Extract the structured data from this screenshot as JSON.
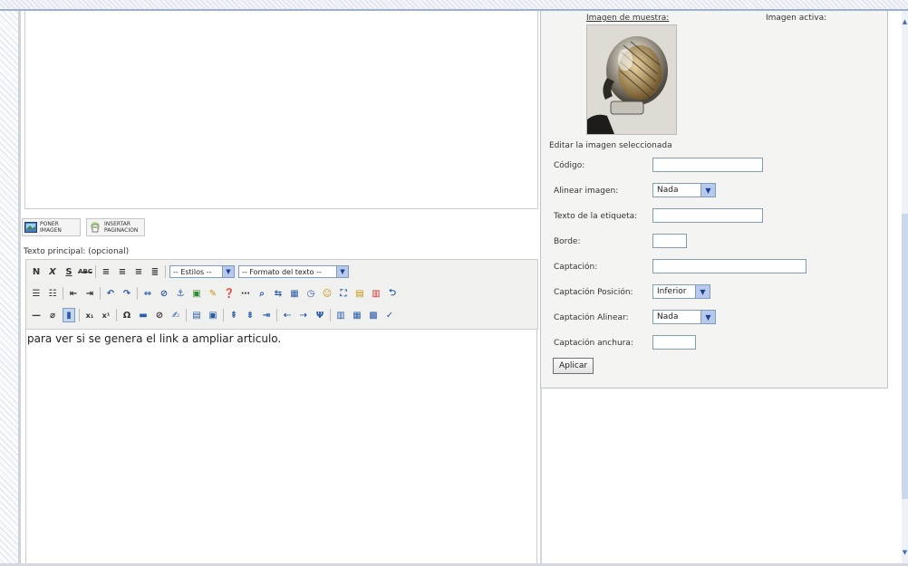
{
  "editor": {
    "buttons": {
      "insert_image": "PONER IMAGEN",
      "insert_pagebreak": "INSERTAR PAGINACION"
    },
    "main_text_caption": "Texto principal: (opcional)",
    "toolbar": {
      "row1": [
        "N",
        "X",
        "S",
        "ABC"
      ],
      "styles_select": "-- Estilos --",
      "format_select": "-- Formato del texto --"
    },
    "content": "para ver si se genera el link a ampliar articulo."
  },
  "image_panel": {
    "sample_label": "Imagen de muestra:",
    "active_label": "Imagen activa:",
    "edit_title": "Editar la imagen seleccionada",
    "fields": {
      "code_label": "Código:",
      "align_label": "Alinear imagen:",
      "align_value": "Nada",
      "alt_label": "Texto de la etiqueta:",
      "border_label": "Borde:",
      "caption_label": "Captación:",
      "caption_pos_label": "Captación Posición:",
      "caption_pos_value": "Inferior",
      "caption_align_label": "Captación Alinear:",
      "caption_align_value": "Nada",
      "caption_width_label": "Captación anchura:"
    },
    "apply_button": "Aplicar"
  },
  "icons": [
    "image-icon",
    "pagebreak-icon",
    "microphone-image"
  ],
  "colors": {
    "accent": "#7f9db9",
    "toolbar_bg": "#f0f0ee",
    "panel_bg": "#f4f4f2"
  }
}
